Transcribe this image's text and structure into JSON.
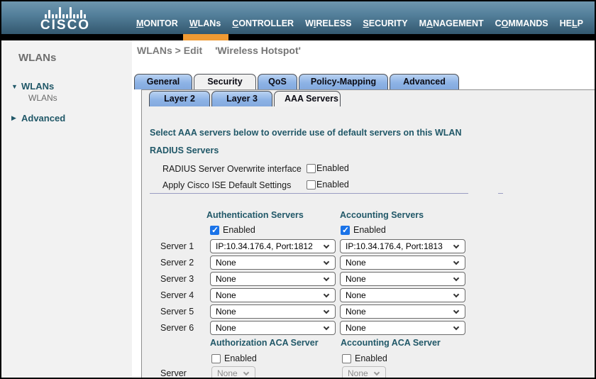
{
  "header": {
    "brand": "CISCO",
    "logo_bar_heights": [
      6,
      12,
      6,
      6,
      16,
      6,
      6,
      16,
      6,
      6,
      12,
      6
    ],
    "nav": [
      {
        "pre": "",
        "key": "M",
        "post": "ONITOR"
      },
      {
        "pre": "",
        "key": "W",
        "post": "LANs"
      },
      {
        "pre": "",
        "key": "C",
        "post": "ONTROLLER"
      },
      {
        "pre": "W",
        "key": "I",
        "post": "RELESS"
      },
      {
        "pre": "",
        "key": "S",
        "post": "ECURITY"
      },
      {
        "pre": "M",
        "key": "A",
        "post": "NAGEMENT"
      },
      {
        "pre": "C",
        "key": "O",
        "post": "MMANDS"
      },
      {
        "pre": "HE",
        "key": "L",
        "post": "P"
      }
    ],
    "active_nav": "WLANs",
    "accent_color": "#ef9a33"
  },
  "sidebar": {
    "title": "WLANs",
    "tree": [
      {
        "label": "WLANs",
        "arrow": "▼",
        "expanded": true
      },
      {
        "label": "Advanced",
        "arrow": "▶",
        "expanded": false
      }
    ],
    "tree_child": "WLANs"
  },
  "main": {
    "breadcrumb_path": "WLANs > Edit",
    "breadcrumb_entity": "'Wireless Hotspot'",
    "tabs": [
      "General",
      "Security",
      "QoS",
      "Policy-Mapping",
      "Advanced"
    ],
    "active_tab": "Security",
    "subtabs": [
      "Layer 2",
      "Layer 3",
      "AAA Servers"
    ],
    "active_subtab": "AAA Servers"
  },
  "form": {
    "intro": "Select AAA servers below to override use of default servers on this WLAN",
    "radius_heading": "RADIUS Servers",
    "overwrite_label": "RADIUS Server Overwrite interface",
    "overwrite_enabled": false,
    "ise_label": "Apply Cisco ISE Default Settings",
    "ise_enabled": false,
    "enabled_label": "Enabled",
    "auth_header": "Authentication Servers",
    "acct_header": "Accounting Servers",
    "auth_enabled": true,
    "acct_enabled": true,
    "server_rows": [
      {
        "label": "Server 1",
        "auth": "IP:10.34.176.4, Port:1812",
        "acct": "IP:10.34.176.4, Port:1813"
      },
      {
        "label": "Server 2",
        "auth": "None",
        "acct": "None"
      },
      {
        "label": "Server 3",
        "auth": "None",
        "acct": "None"
      },
      {
        "label": "Server 4",
        "auth": "None",
        "acct": "None"
      },
      {
        "label": "Server 5",
        "auth": "None",
        "acct": "None"
      },
      {
        "label": "Server 6",
        "auth": "None",
        "acct": "None"
      }
    ],
    "authz_aca_header": "Authorization ACA Server",
    "acct_aca_header": "Accounting ACA Server",
    "authz_aca_enabled": false,
    "acct_aca_enabled": false,
    "aca_server_label": "Server",
    "aca_authz_value": "None",
    "aca_acct_value": "None"
  }
}
